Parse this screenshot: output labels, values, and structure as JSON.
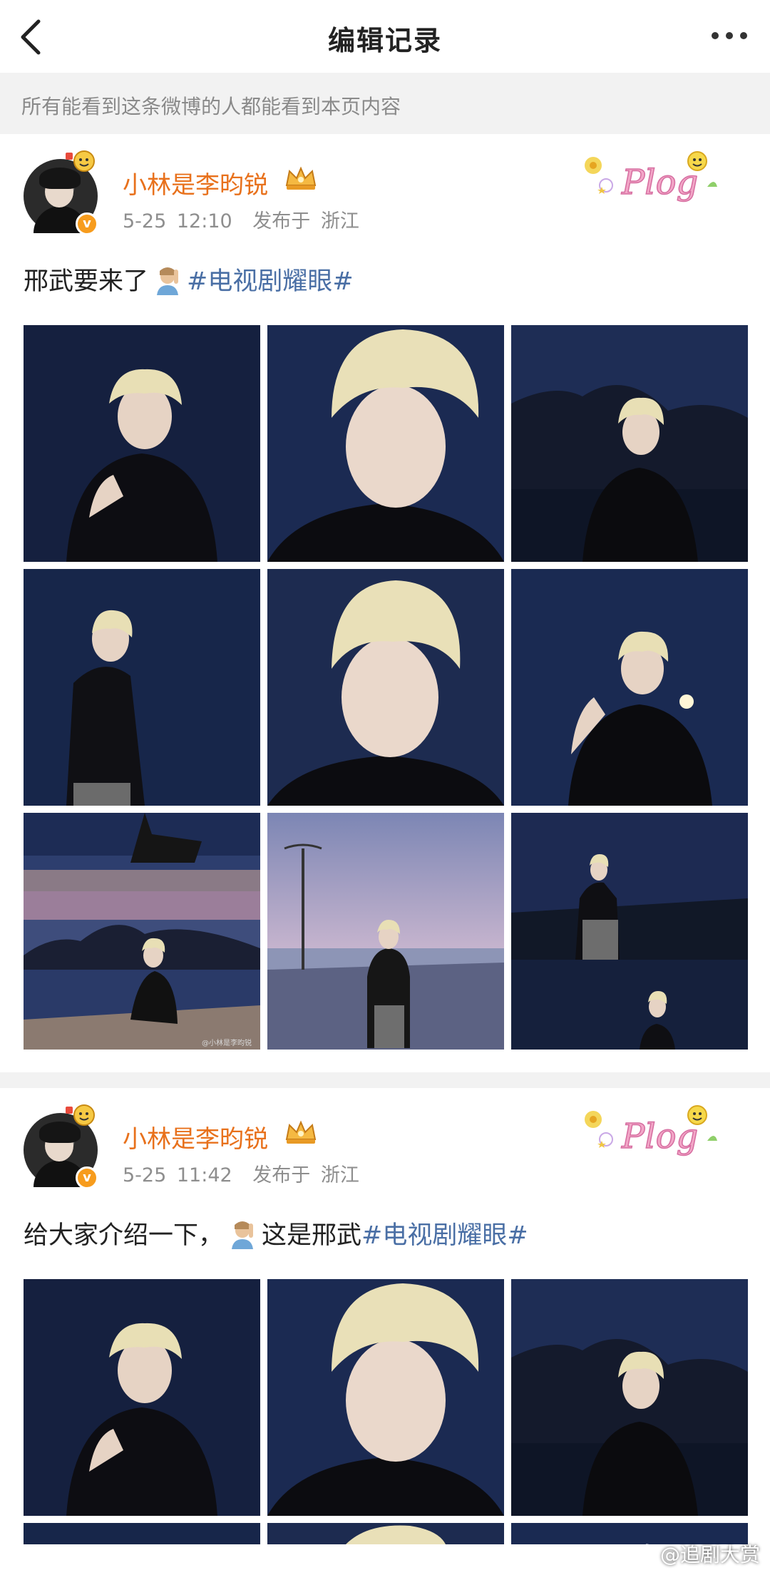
{
  "header": {
    "title": "编辑记录"
  },
  "notice": "所有能看到这条微博的人都能看到本页内容",
  "posts": [
    {
      "username": "小林是李昀锐",
      "time": "5-25 12:10",
      "location": "发布于 浙江",
      "text_before": "邢武要来了",
      "text_middle": "",
      "hashtag": "#电视剧耀眼#",
      "image_caption": "@小林是李昀锐"
    },
    {
      "username": "小林是李昀锐",
      "time": "5-25 11:42",
      "location": "发布于 浙江",
      "text_before": "给大家介绍一下，",
      "text_middle": "这是邢武",
      "hashtag": "#电视剧耀眼#"
    }
  ],
  "watermark": "@追剧大赏",
  "colors": {
    "username": "#e8711c",
    "hashtag": "#4a6fa5",
    "badge": "#f79c1d",
    "notice_bg": "#f2f2f2"
  }
}
